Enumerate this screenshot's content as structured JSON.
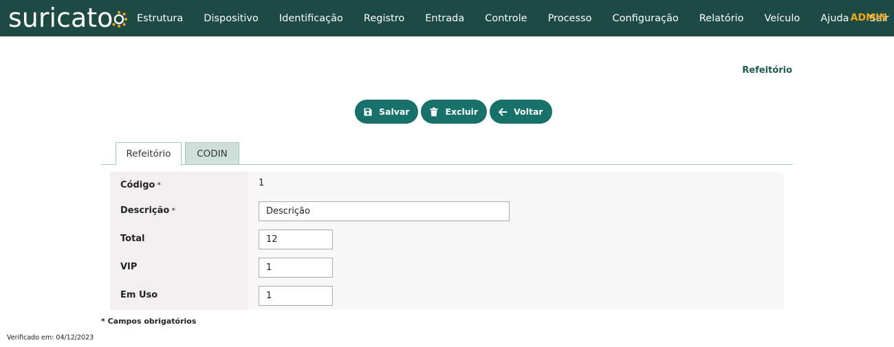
{
  "app": {
    "logo_text": "suricato",
    "brand_colors": {
      "header": "#1d4b43",
      "accent": "#f2a81d",
      "button": "#17706a"
    }
  },
  "nav": {
    "items": [
      "Estrutura",
      "Dispositivo",
      "Identificação",
      "Registro",
      "Entrada",
      "Controle",
      "Processo",
      "Configuração",
      "Relatório",
      "Veículo",
      "Ajuda",
      "Sair"
    ],
    "user": "ADMIN"
  },
  "page": {
    "heading": "Refeitório"
  },
  "actions": {
    "save": {
      "label": "Salvar",
      "icon": "floppy-disk-icon"
    },
    "delete": {
      "label": "Excluir",
      "icon": "trash-icon"
    },
    "back": {
      "label": "Voltar",
      "icon": "arrow-left-icon"
    }
  },
  "tabs": [
    {
      "label": "Refeitório",
      "active": true
    },
    {
      "label": "CODIN",
      "active": false
    }
  ],
  "form": {
    "codigo": {
      "label": "Código",
      "required": "*",
      "value": "1"
    },
    "descricao": {
      "label": "Descrição",
      "required": "*",
      "value": "Descrição"
    },
    "total": {
      "label": "Total",
      "value": "12"
    },
    "vip": {
      "label": "VIP",
      "value": "1"
    },
    "em_uso": {
      "label": "Em Uso",
      "value": "1"
    }
  },
  "footer": {
    "required_note": "* Campos obrigatórios",
    "verified": "Verificado em: 04/12/2023"
  }
}
